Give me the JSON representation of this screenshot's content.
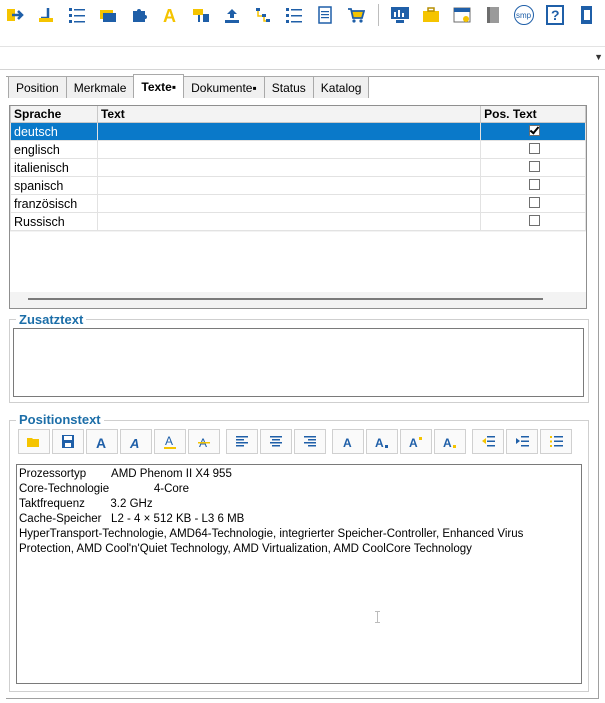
{
  "toolbar": {
    "icons": [
      "import-arrow-icon",
      "tool-icon",
      "list-icon",
      "folders-icon",
      "puzzle-icon",
      "font-a-icon",
      "paint-icon",
      "upload-icon",
      "tree-icon",
      "numbered-list-icon",
      "document-icon",
      "shopping-cart-icon",
      "monitor-chart-icon",
      "briefcase-icon",
      "calendar-icon",
      "book-icon",
      "smp-icon",
      "help-icon",
      "exit-door-icon"
    ],
    "smp_label": "smp",
    "help_label": "?"
  },
  "tabs": [
    {
      "label": "Position"
    },
    {
      "label": "Merkmale"
    },
    {
      "label": "Texte▪"
    },
    {
      "label": "Dokumente▪"
    },
    {
      "label": "Status"
    },
    {
      "label": "Katalog"
    }
  ],
  "grid": {
    "columns": [
      "Sprache",
      "Text",
      "Pos. Text"
    ],
    "rows": [
      {
        "sprache": "deutsch",
        "text": "",
        "pos_text": true
      },
      {
        "sprache": "englisch",
        "text": "",
        "pos_text": false
      },
      {
        "sprache": "italienisch",
        "text": "",
        "pos_text": false
      },
      {
        "sprache": "spanisch",
        "text": "",
        "pos_text": false
      },
      {
        "sprache": "französisch",
        "text": "",
        "pos_text": false
      },
      {
        "sprache": "Russisch",
        "text": "",
        "pos_text": false
      }
    ]
  },
  "zusatztext": {
    "title": "Zusatztext",
    "value": ""
  },
  "positionstext": {
    "title": "Positionstext",
    "format_buttons": [
      "open-folder-icon",
      "save-icon",
      "bold-icon",
      "italic-icon",
      "underline-icon",
      "strikethrough-icon",
      "align-left-icon",
      "align-center-icon",
      "align-right-icon",
      "font-color-icon",
      "font-size-down-icon",
      "font-size-up-icon",
      "highlight-icon",
      "outdent-icon",
      "indent-icon",
      "bullet-list-icon"
    ],
    "lines": [
      "Prozessortyp        AMD Phenom II X4 955",
      "Core-Technologie              4-Core",
      "Taktfrequenz        3.2 GHz",
      "Cache-Speicher   L2 - 4 × 512 KB - L3 6 MB",
      "HyperTransport-Technologie, AMD64-Technologie, integrierter Speicher-Controller, Enhanced Virus Protection, AMD Cool'n'Quiet Technology, AMD Virtualization, AMD CoolCore Technology"
    ]
  },
  "colors": {
    "selection": "#0a79c9",
    "group_title": "#1c6ea8",
    "toolbar_blue": "#1f5fa8",
    "toolbar_yellow": "#f5c400"
  }
}
